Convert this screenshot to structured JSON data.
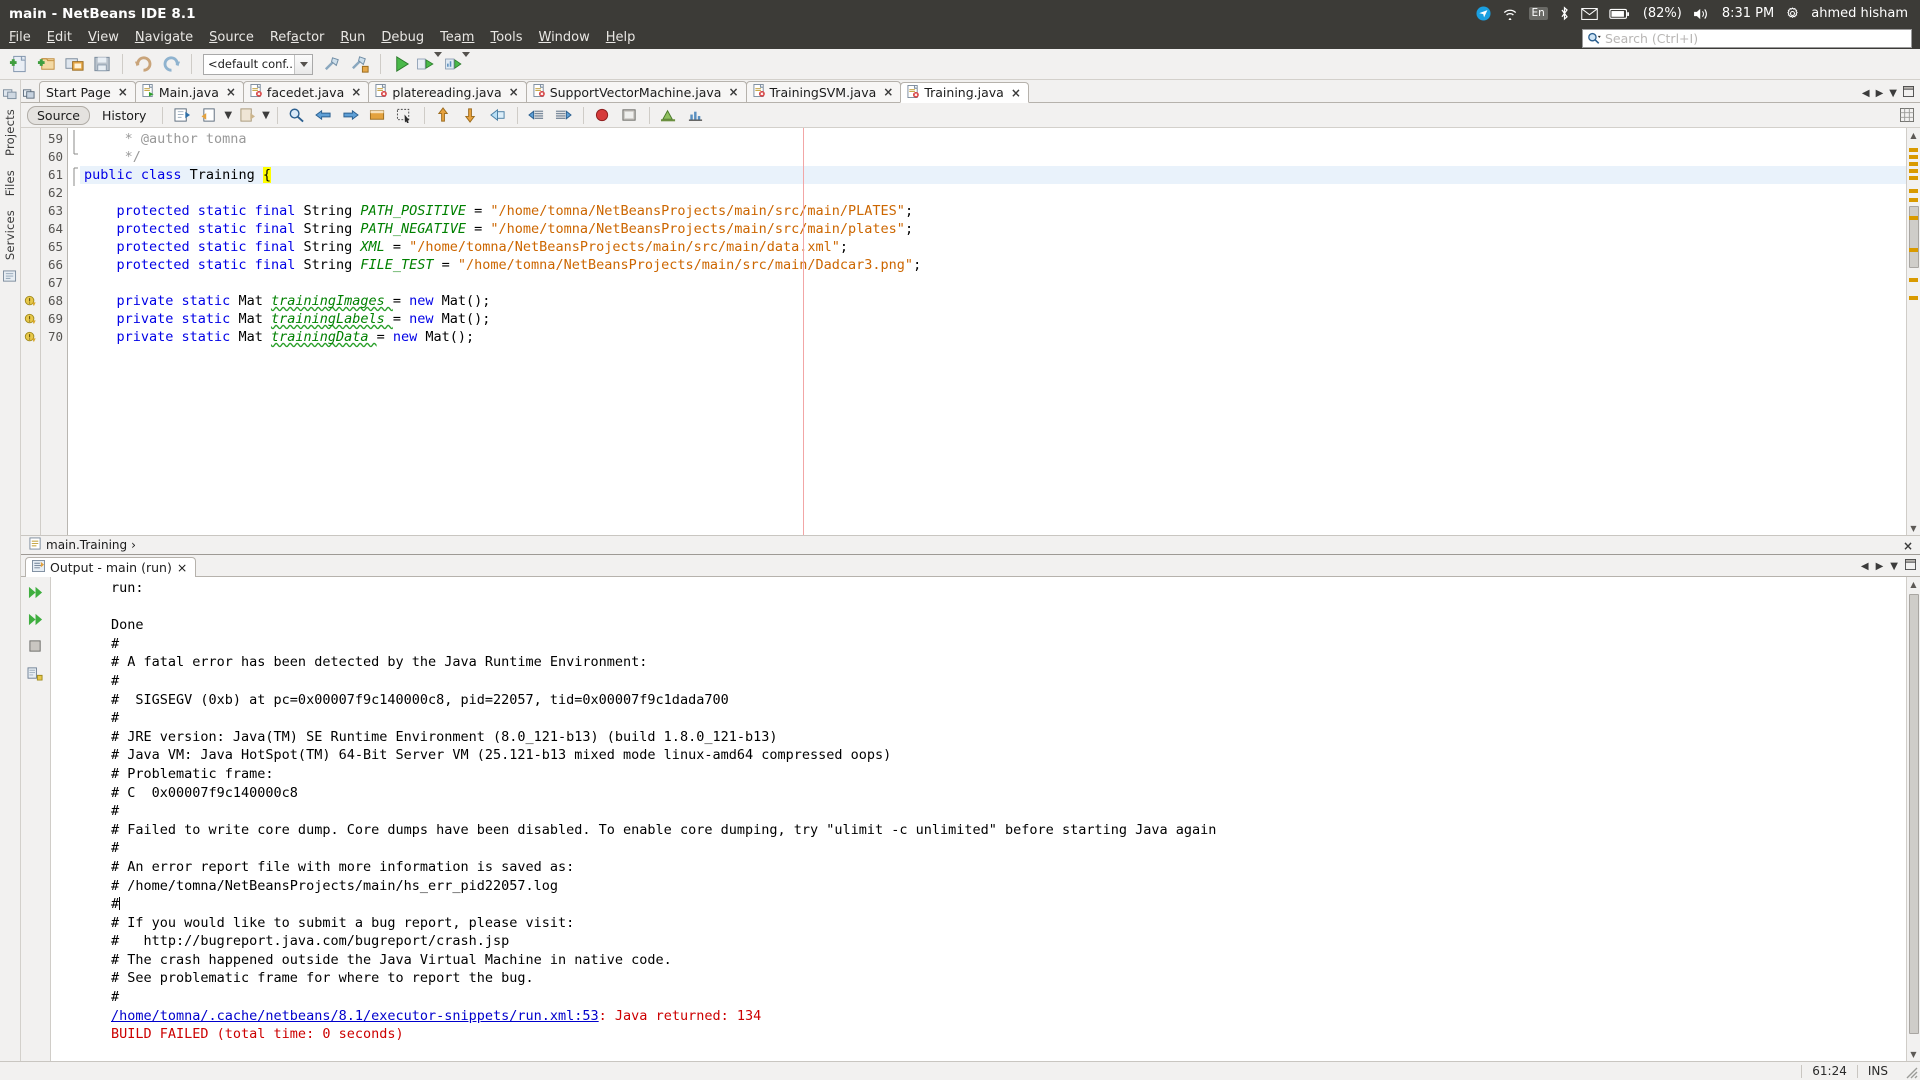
{
  "window": {
    "title": "main - NetBeans IDE 8.1"
  },
  "system_tray": {
    "keyboard_layout": "En",
    "battery_percent": "(82%)",
    "clock": "8:31 PM",
    "user": "ahmed hisham",
    "icons": [
      "messaging-icon",
      "wifi-icon",
      "keyboard-layout-icon",
      "bluetooth-icon",
      "mail-icon",
      "battery-icon",
      "volume-icon",
      "gear-icon"
    ]
  },
  "menubar": {
    "items": [
      {
        "label": "File",
        "mnemonic": "F"
      },
      {
        "label": "Edit",
        "mnemonic": "E"
      },
      {
        "label": "View",
        "mnemonic": "V"
      },
      {
        "label": "Navigate",
        "mnemonic": "N"
      },
      {
        "label": "Source",
        "mnemonic": "S"
      },
      {
        "label": "Refactor",
        "mnemonic": "a"
      },
      {
        "label": "Run",
        "mnemonic": "R"
      },
      {
        "label": "Debug",
        "mnemonic": "D"
      },
      {
        "label": "Team",
        "mnemonic": "m"
      },
      {
        "label": "Tools",
        "mnemonic": "T"
      },
      {
        "label": "Window",
        "mnemonic": "W"
      },
      {
        "label": "Help",
        "mnemonic": "H"
      }
    ]
  },
  "search": {
    "placeholder": "Search (Ctrl+I)",
    "value": ""
  },
  "toolbar": {
    "config_value": "<default conf...",
    "buttons": [
      "new-file-icon",
      "new-project-icon",
      "open-project-icon",
      "save-all-icon",
      "undo-icon",
      "redo-icon",
      "build-project-icon",
      "clean-build-icon",
      "run-project-icon",
      "debug-project-icon",
      "profile-project-icon"
    ]
  },
  "dock_strip": {
    "left_labels": [
      "Projects",
      "Files",
      "Services"
    ]
  },
  "editor_tabs": {
    "items": [
      {
        "label": "Start Page",
        "icon": "",
        "active": false,
        "closable": true
      },
      {
        "label": "Main.java",
        "icon": "java-main-icon",
        "active": false,
        "closable": true
      },
      {
        "label": "facedet.java",
        "icon": "java-error-icon",
        "active": false,
        "closable": true
      },
      {
        "label": "platereading.java",
        "icon": "java-error-icon",
        "active": false,
        "closable": true
      },
      {
        "label": "SupportVectorMachine.java",
        "icon": "java-error-icon",
        "active": false,
        "closable": true
      },
      {
        "label": "TrainingSVM.java",
        "icon": "java-error-icon",
        "active": false,
        "closable": true
      },
      {
        "label": "Training.java",
        "icon": "java-error-icon",
        "active": true,
        "closable": true
      }
    ],
    "right_controls": [
      "scroll-left-icon",
      "scroll-right-icon",
      "tab-list-icon",
      "maximize-icon"
    ]
  },
  "source_bar": {
    "source_label": "Source",
    "history_label": "History",
    "buttons": [
      "last-edit-icon",
      "back-icon",
      "forward-icon",
      "find-selection-icon",
      "previous-bookmark-icon",
      "next-bookmark-icon",
      "toggle-rectangular-icon",
      "shift-left-icon",
      "shift-right-icon",
      "start-macro-icon",
      "stop-macro-icon",
      "comment-icon",
      "uncomment-icon",
      "toggle-breakpoint-icon",
      "inspect-icon"
    ]
  },
  "editor": {
    "first_line_number": 59,
    "lines": [
      {
        "num": 59,
        "glyph": "",
        "fold": "mid",
        "highlight": false,
        "tokens": [
          {
            "t": "     * @author tomna",
            "c": "cmt"
          }
        ]
      },
      {
        "num": 60,
        "glyph": "",
        "fold": "end",
        "highlight": false,
        "tokens": [
          {
            "t": "     */",
            "c": "cmt"
          }
        ]
      },
      {
        "num": 61,
        "glyph": "",
        "fold": "start",
        "highlight": true,
        "tokens": [
          {
            "t": "public class ",
            "c": "kw"
          },
          {
            "t": "Training ",
            "c": "pln"
          },
          {
            "t": "{",
            "c": "brace"
          }
        ]
      },
      {
        "num": 62,
        "glyph": "",
        "fold": "",
        "highlight": false,
        "tokens": [
          {
            "t": "",
            "c": "pln"
          }
        ]
      },
      {
        "num": 63,
        "glyph": "",
        "fold": "",
        "highlight": false,
        "tokens": [
          {
            "t": "    ",
            "c": "pln"
          },
          {
            "t": "protected static final ",
            "c": "kw"
          },
          {
            "t": "String ",
            "c": "pln"
          },
          {
            "t": "PATH_POSITIVE ",
            "c": "fld"
          },
          {
            "t": "= ",
            "c": "pln"
          },
          {
            "t": "\"/home/tomna/NetBeansProjects/main/src/main/PLATES\"",
            "c": "str"
          },
          {
            "t": ";",
            "c": "pln"
          }
        ]
      },
      {
        "num": 64,
        "glyph": "",
        "fold": "",
        "highlight": false,
        "tokens": [
          {
            "t": "    ",
            "c": "pln"
          },
          {
            "t": "protected static final ",
            "c": "kw"
          },
          {
            "t": "String ",
            "c": "pln"
          },
          {
            "t": "PATH_NEGATIVE ",
            "c": "fld"
          },
          {
            "t": "= ",
            "c": "pln"
          },
          {
            "t": "\"/home/tomna/NetBeansProjects/main/src/main/plates\"",
            "c": "str"
          },
          {
            "t": ";",
            "c": "pln"
          }
        ]
      },
      {
        "num": 65,
        "glyph": "",
        "fold": "",
        "highlight": false,
        "tokens": [
          {
            "t": "    ",
            "c": "pln"
          },
          {
            "t": "protected static final ",
            "c": "kw"
          },
          {
            "t": "String ",
            "c": "pln"
          },
          {
            "t": "XML ",
            "c": "fld"
          },
          {
            "t": "= ",
            "c": "pln"
          },
          {
            "t": "\"/home/tomna/NetBeansProjects/main/src/main/data.xml\"",
            "c": "str"
          },
          {
            "t": ";",
            "c": "pln"
          }
        ]
      },
      {
        "num": 66,
        "glyph": "",
        "fold": "",
        "highlight": false,
        "tokens": [
          {
            "t": "    ",
            "c": "pln"
          },
          {
            "t": "protected static final ",
            "c": "kw"
          },
          {
            "t": "String ",
            "c": "pln"
          },
          {
            "t": "FILE_TEST ",
            "c": "fld"
          },
          {
            "t": "= ",
            "c": "pln"
          },
          {
            "t": "\"/home/tomna/NetBeansProjects/main/src/main/Dadcar3.png\"",
            "c": "str"
          },
          {
            "t": ";",
            "c": "pln"
          }
        ]
      },
      {
        "num": 67,
        "glyph": "",
        "fold": "",
        "highlight": false,
        "tokens": [
          {
            "t": "",
            "c": "pln"
          }
        ]
      },
      {
        "num": 68,
        "glyph": "warning",
        "fold": "",
        "highlight": false,
        "tokens": [
          {
            "t": "    ",
            "c": "pln"
          },
          {
            "t": "private static ",
            "c": "kw"
          },
          {
            "t": "Mat ",
            "c": "pln"
          },
          {
            "t": "trainingImages ",
            "c": "fldw"
          },
          {
            "t": "= ",
            "c": "pln"
          },
          {
            "t": "new ",
            "c": "kw"
          },
          {
            "t": "Mat();",
            "c": "pln"
          }
        ]
      },
      {
        "num": 69,
        "glyph": "warning",
        "fold": "",
        "highlight": false,
        "tokens": [
          {
            "t": "    ",
            "c": "pln"
          },
          {
            "t": "private static ",
            "c": "kw"
          },
          {
            "t": "Mat ",
            "c": "pln"
          },
          {
            "t": "trainingLabels ",
            "c": "fldw"
          },
          {
            "t": "= ",
            "c": "pln"
          },
          {
            "t": "new ",
            "c": "kw"
          },
          {
            "t": "Mat();",
            "c": "pln"
          }
        ]
      },
      {
        "num": 70,
        "glyph": "warning",
        "fold": "",
        "highlight": false,
        "tokens": [
          {
            "t": "    ",
            "c": "pln"
          },
          {
            "t": "private static ",
            "c": "kw"
          },
          {
            "t": "Mat ",
            "c": "pln"
          },
          {
            "t": "trainingData ",
            "c": "fldw"
          },
          {
            "t": "= ",
            "c": "pln"
          },
          {
            "t": "new ",
            "c": "kw"
          },
          {
            "t": "Mat();",
            "c": "pln"
          }
        ]
      }
    ]
  },
  "breadcrumb": {
    "text": "main.Training",
    "separator": "›",
    "icon": "class-icon",
    "close_label": "×"
  },
  "output": {
    "tab_label": "Output - main (run)",
    "tab_icon": "output-icon",
    "tab_close": "×",
    "right_controls": [
      "scroll-left-icon",
      "scroll-right-icon",
      "tab-list-icon",
      "maximize-icon"
    ],
    "side_buttons": [
      "rerun-icon",
      "rerun-alt-icon",
      "stop-icon",
      "clear-icon"
    ],
    "lines": [
      {
        "text": "run:",
        "style": "plain"
      },
      {
        "text": "",
        "style": "plain"
      },
      {
        "text": "Done",
        "style": "plain"
      },
      {
        "text": "#",
        "style": "plain"
      },
      {
        "text": "# A fatal error has been detected by the Java Runtime Environment:",
        "style": "plain"
      },
      {
        "text": "#",
        "style": "plain"
      },
      {
        "text": "#  SIGSEGV (0xb) at pc=0x00007f9c140000c8, pid=22057, tid=0x00007f9c1dada700",
        "style": "plain"
      },
      {
        "text": "#",
        "style": "plain"
      },
      {
        "text": "# JRE version: Java(TM) SE Runtime Environment (8.0_121-b13) (build 1.8.0_121-b13)",
        "style": "plain"
      },
      {
        "text": "# Java VM: Java HotSpot(TM) 64-Bit Server VM (25.121-b13 mixed mode linux-amd64 compressed oops)",
        "style": "plain"
      },
      {
        "text": "# Problematic frame:",
        "style": "plain"
      },
      {
        "text": "# C  0x00007f9c140000c8",
        "style": "plain"
      },
      {
        "text": "#",
        "style": "plain"
      },
      {
        "text": "# Failed to write core dump. Core dumps have been disabled. To enable core dumping, try \"ulimit -c unlimited\" before starting Java again",
        "style": "plain"
      },
      {
        "text": "#",
        "style": "plain"
      },
      {
        "text": "# An error report file with more information is saved as:",
        "style": "plain"
      },
      {
        "text": "# /home/tomna/NetBeansProjects/main/hs_err_pid22057.log",
        "style": "plain"
      },
      {
        "text": "#",
        "style": "caret"
      },
      {
        "text": "# If you would like to submit a bug report, please visit:",
        "style": "plain"
      },
      {
        "text": "#   http://bugreport.java.com/bugreport/crash.jsp",
        "style": "plain"
      },
      {
        "text": "# The crash happened outside the Java Virtual Machine in native code.",
        "style": "plain"
      },
      {
        "text": "# See problematic frame for where to report the bug.",
        "style": "plain"
      },
      {
        "text": "#",
        "style": "plain"
      },
      {
        "text": "/home/tomna/.cache/netbeans/8.1/executor-snippets/run.xml:53",
        "suffix": ": Java returned: 134",
        "style": "link-red"
      },
      {
        "text": "BUILD FAILED (total time: 0 seconds)",
        "style": "red"
      }
    ]
  },
  "statusbar": {
    "position": "61:24",
    "insert_mode": "INS"
  },
  "colors": {
    "panel_bg": "#3c3b37",
    "ide_bg": "#f2f1f0",
    "editor_bg": "#ffffff",
    "keyword": "#0000e6",
    "string": "#cc6600",
    "field": "#008000",
    "comment": "#999999",
    "error_red": "#cc0000",
    "link_blue": "#0000cc",
    "highlight_line": "#e9f2fb"
  }
}
